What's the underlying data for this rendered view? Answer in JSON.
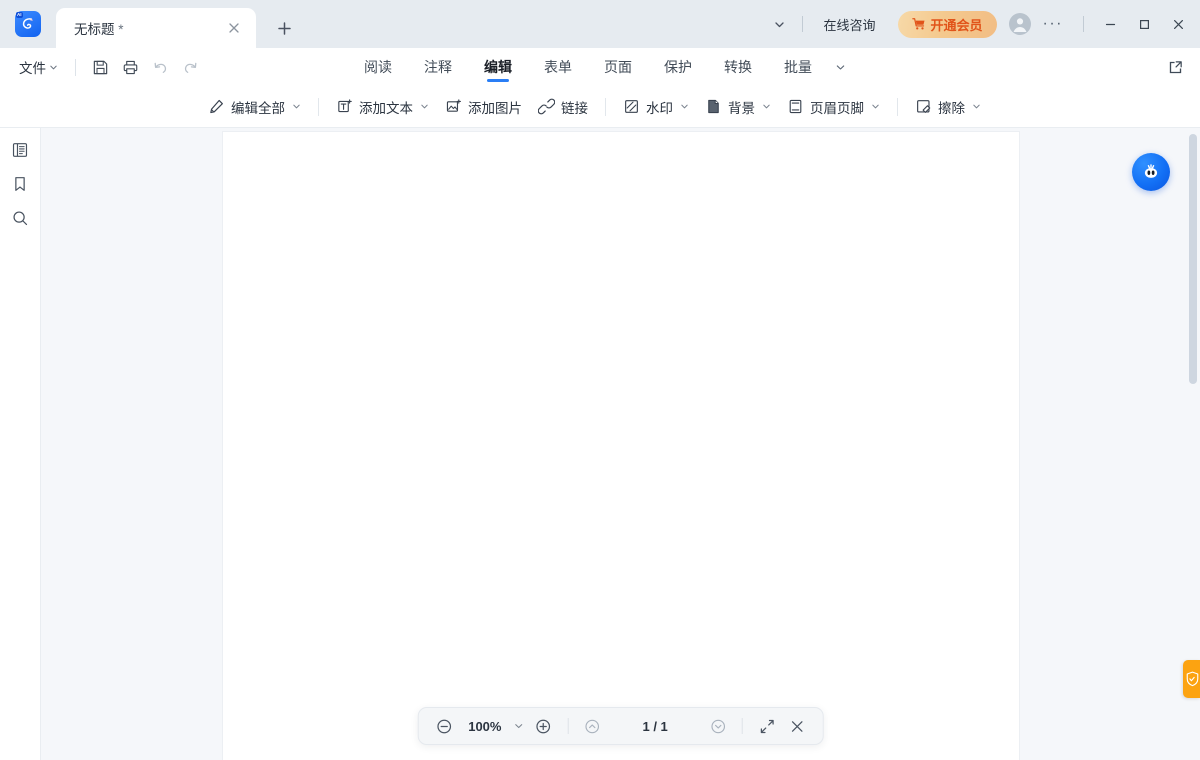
{
  "app": {
    "logo_badge": "AI"
  },
  "titlebar": {
    "tab": {
      "title": "无标题",
      "dirty_marker": "*",
      "close_icon": "close-icon"
    },
    "new_tab_icon": "plus-icon",
    "tabs_overflow_icon": "chevron-down-icon",
    "consult_label": "在线咨询",
    "vip_label": "开通会员",
    "vip_icon": "cart-icon",
    "vip_color": "#e1541a",
    "avatar_icon": "user-avatar-icon",
    "more_icon": "ellipsis-icon",
    "minimize_icon": "minimize-icon",
    "maximize_icon": "maximize-icon",
    "close_icon": "window-close-icon"
  },
  "menubar": {
    "file_label": "文件",
    "file_chevron": "chevron-down-icon",
    "quick_actions": [
      {
        "name": "save-button",
        "icon": "save-icon",
        "disabled": false
      },
      {
        "name": "print-button",
        "icon": "print-icon",
        "disabled": false
      },
      {
        "name": "undo-button",
        "icon": "undo-icon",
        "disabled": true
      },
      {
        "name": "redo-button",
        "icon": "redo-icon",
        "disabled": true
      }
    ],
    "tabs": [
      {
        "label": "阅读",
        "active": false
      },
      {
        "label": "注释",
        "active": false
      },
      {
        "label": "编辑",
        "active": true
      },
      {
        "label": "表单",
        "active": false
      },
      {
        "label": "页面",
        "active": false
      },
      {
        "label": "保护",
        "active": false
      },
      {
        "label": "转换",
        "active": false
      },
      {
        "label": "批量",
        "active": false
      }
    ],
    "tabs_more_icon": "chevron-down-icon",
    "active_underline_color": "#2a7ef5",
    "expand_icon": "open-external-icon"
  },
  "ribbon": {
    "items": [
      {
        "label": "编辑全部",
        "icon": "edit-pencil-icon",
        "has_chevron": true,
        "name": "edit-all-button"
      },
      {
        "separator": true
      },
      {
        "label": "添加文本",
        "icon": "add-text-icon",
        "has_chevron": true,
        "name": "add-text-button"
      },
      {
        "label": "添加图片",
        "icon": "add-image-icon",
        "has_chevron": false,
        "name": "add-image-button"
      },
      {
        "label": "链接",
        "icon": "link-icon",
        "has_chevron": false,
        "name": "link-button"
      },
      {
        "separator": true
      },
      {
        "label": "水印",
        "icon": "watermark-icon",
        "has_chevron": true,
        "name": "watermark-button"
      },
      {
        "label": "背景",
        "icon": "background-icon",
        "has_chevron": true,
        "name": "background-button"
      },
      {
        "label": "页眉页脚",
        "icon": "header-footer-icon",
        "has_chevron": true,
        "name": "header-footer-button"
      },
      {
        "separator": true
      },
      {
        "label": "擦除",
        "icon": "eraser-icon",
        "has_chevron": true,
        "name": "erase-button"
      }
    ]
  },
  "left_rail": {
    "items": [
      {
        "icon": "thumbnails-panel-icon",
        "name": "sidebar-item-thumbnails"
      },
      {
        "icon": "bookmark-icon",
        "name": "sidebar-item-bookmarks"
      },
      {
        "icon": "search-icon",
        "name": "sidebar-item-search"
      }
    ]
  },
  "document": {
    "page_background": "#ffffff",
    "canvas_background": "#f5f7fa"
  },
  "assistant": {
    "icon": "ai-mascot-icon",
    "color": "#1370f5"
  },
  "side_tab": {
    "icon": "shield-icon",
    "color": "#fca311"
  },
  "bottombar": {
    "zoom_out_icon": "zoom-out-icon",
    "zoom_level": "100%",
    "zoom_chevron": "chevron-down-icon",
    "zoom_in_icon": "zoom-in-icon",
    "prev_page_icon": "chevron-up-circle-icon",
    "page_indicator": "1 / 1",
    "next_page_icon": "chevron-down-circle-icon",
    "fit_icon": "fit-screen-icon",
    "close_icon": "close-icon"
  }
}
